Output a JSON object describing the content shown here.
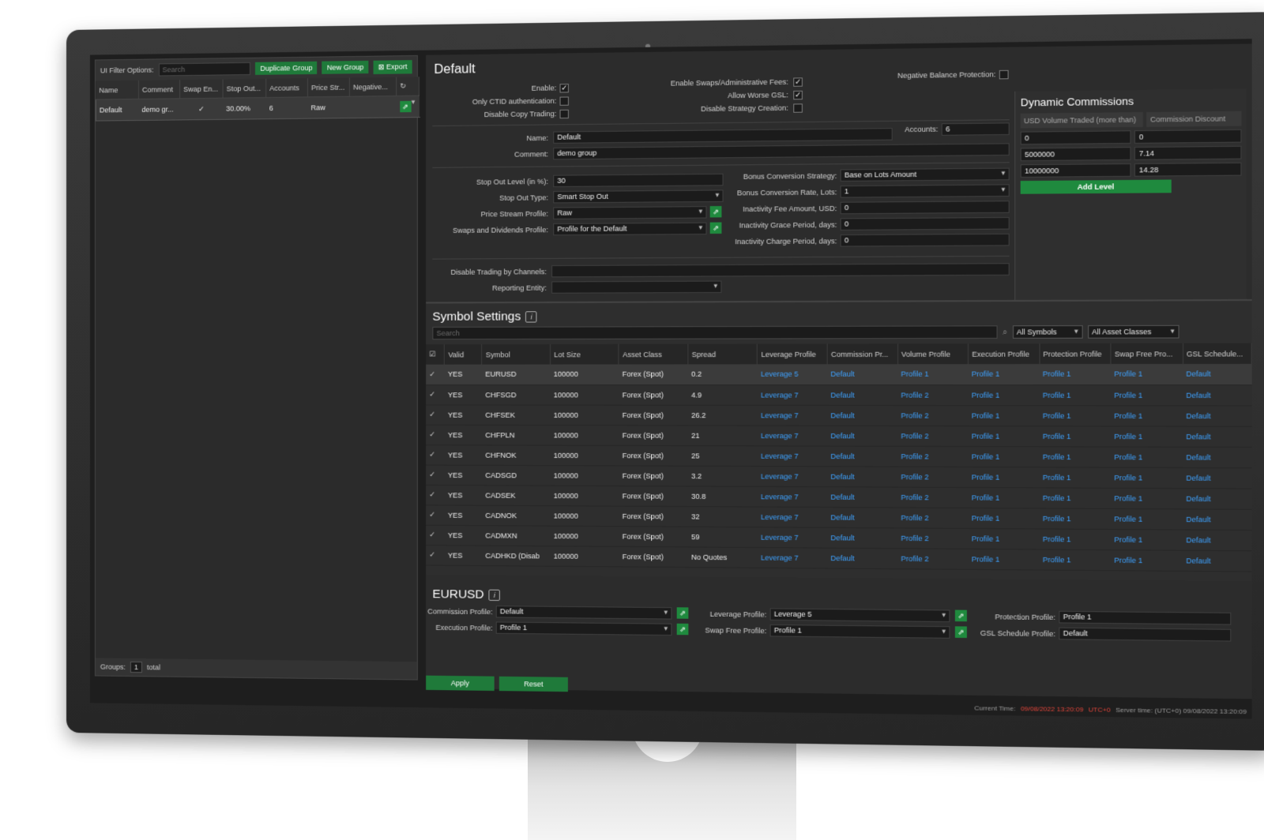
{
  "left_panel": {
    "filter_label": "UI Filter Options:",
    "search_placeholder": "Search",
    "duplicate_label": "Duplicate Group",
    "new_group_label": "New Group",
    "export_label": "Export",
    "columns": [
      "Name",
      "Comment",
      "Swap En...",
      "Stop Out...",
      "Accounts",
      "Price Str...",
      "Negative..."
    ],
    "rows": [
      {
        "name": "Default",
        "comment": "demo gr...",
        "swap": "✓",
        "stop_out": "30.00%",
        "accounts": "6",
        "price_stream": "Raw"
      }
    ],
    "groups_label": "Groups:",
    "groups_count": "1",
    "total_label": "total"
  },
  "group_form": {
    "title": "Default",
    "enable_label": "Enable:",
    "only_ctid_label": "Only CTID authentication:",
    "disable_copy_label": "Disable Copy Trading:",
    "enable_swaps_label": "Enable Swaps/Administrative Fees:",
    "allow_worse_gsl_label": "Allow Worse GSL:",
    "disable_strategy_label": "Disable Strategy Creation:",
    "negative_balance_label": "Negative Balance Protection:",
    "name_label": "Name:",
    "name_value": "Default",
    "accounts_label": "Accounts:",
    "accounts_value": "6",
    "comment_label": "Comment:",
    "comment_value": "demo group",
    "stop_out_level_label": "Stop Out Level (in %):",
    "stop_out_level_value": "30",
    "stop_out_type_label": "Stop Out Type:",
    "stop_out_type_value": "Smart Stop Out",
    "price_stream_label": "Price Stream Profile:",
    "price_stream_value": "Raw",
    "swaps_dividends_label": "Swaps and Dividends Profile:",
    "swaps_dividends_value": "Profile for the Default",
    "bonus_strategy_label": "Bonus Conversion Strategy:",
    "bonus_strategy_value": "Base on Lots Amount",
    "bonus_rate_label": "Bonus Conversion Rate, Lots:",
    "bonus_rate_value": "1",
    "inactivity_fee_label": "Inactivity Fee Amount, USD:",
    "inactivity_fee_value": "0",
    "inactivity_grace_label": "Inactivity Grace Period, days:",
    "inactivity_grace_value": "0",
    "inactivity_charge_label": "Inactivity Charge Period, days:",
    "inactivity_charge_value": "0",
    "disable_channels_label": "Disable Trading by Channels:",
    "reporting_entity_label": "Reporting Entity:"
  },
  "dynamic_commissions": {
    "title": "Dynamic Commissions",
    "col_volume": "USD Volume Traded (more than)",
    "col_discount": "Commission Discount",
    "rows": [
      [
        "0",
        "0"
      ],
      [
        "5000000",
        "7.14"
      ],
      [
        "10000000",
        "14.28"
      ]
    ],
    "add_level_label": "Add Level"
  },
  "symbol_settings": {
    "title": "Symbol Settings",
    "search_placeholder": "Search",
    "symbols_filter": "All Symbols",
    "asset_filter": "All Asset Classes",
    "columns": [
      "Valid",
      "Symbol",
      "Lot Size",
      "Asset Class",
      "Spread",
      "Leverage Profile",
      "Commission Pr...",
      "Volume Profile",
      "Execution Profile",
      "Protection Profile",
      "Swap Free Pro...",
      "GSL Schedule..."
    ],
    "rows": [
      [
        "YES",
        "EURUSD",
        "100000",
        "Forex (Spot)",
        "0.2",
        "Leverage 5",
        "Default",
        "Profile 1",
        "Profile 1",
        "Profile 1",
        "Profile 1",
        "Default"
      ],
      [
        "YES",
        "CHFSGD",
        "100000",
        "Forex (Spot)",
        "4.9",
        "Leverage 7",
        "Default",
        "Profile 2",
        "Profile 1",
        "Profile 1",
        "Profile 1",
        "Default"
      ],
      [
        "YES",
        "CHFSEK",
        "100000",
        "Forex (Spot)",
        "26.2",
        "Leverage 7",
        "Default",
        "Profile 2",
        "Profile 1",
        "Profile 1",
        "Profile 1",
        "Default"
      ],
      [
        "YES",
        "CHFPLN",
        "100000",
        "Forex (Spot)",
        "21",
        "Leverage 7",
        "Default",
        "Profile 2",
        "Profile 1",
        "Profile 1",
        "Profile 1",
        "Default"
      ],
      [
        "YES",
        "CHFNOK",
        "100000",
        "Forex (Spot)",
        "25",
        "Leverage 7",
        "Default",
        "Profile 2",
        "Profile 1",
        "Profile 1",
        "Profile 1",
        "Default"
      ],
      [
        "YES",
        "CADSGD",
        "100000",
        "Forex (Spot)",
        "3.2",
        "Leverage 7",
        "Default",
        "Profile 2",
        "Profile 1",
        "Profile 1",
        "Profile 1",
        "Default"
      ],
      [
        "YES",
        "CADSEK",
        "100000",
        "Forex (Spot)",
        "30.8",
        "Leverage 7",
        "Default",
        "Profile 2",
        "Profile 1",
        "Profile 1",
        "Profile 1",
        "Default"
      ],
      [
        "YES",
        "CADNOK",
        "100000",
        "Forex (Spot)",
        "32",
        "Leverage 7",
        "Default",
        "Profile 2",
        "Profile 1",
        "Profile 1",
        "Profile 1",
        "Default"
      ],
      [
        "YES",
        "CADMXN",
        "100000",
        "Forex (Spot)",
        "59",
        "Leverage 7",
        "Default",
        "Profile 2",
        "Profile 1",
        "Profile 1",
        "Profile 1",
        "Default"
      ],
      [
        "YES",
        "CADHKD (Disab",
        "100000",
        "Forex (Spot)",
        "No Quotes",
        "Leverage 7",
        "Default",
        "Profile 2",
        "Profile 1",
        "Profile 1",
        "Profile 1",
        "Default"
      ]
    ]
  },
  "symbol_detail": {
    "title": "EURUSD",
    "commission_label": "Commission Profile:",
    "commission_value": "Default",
    "leverage_label": "Leverage Profile:",
    "leverage_value": "Leverage 5",
    "protection_label": "Protection Profile:",
    "protection_value": "Profile 1",
    "execution_label": "Execution Profile:",
    "execution_value": "Profile 1",
    "swap_free_label": "Swap Free Profile:",
    "swap_free_value": "Profile 1",
    "gsl_label": "GSL Schedule Profile:",
    "gsl_value": "Default"
  },
  "actions": {
    "apply_label": "Apply",
    "reset_label": "Reset"
  },
  "status_bar": {
    "current_time_label": "Current Time:",
    "current_time_value": "09/08/2022 13:20:09",
    "tz": "UTC+0",
    "server_time": "Server time: (UTC+0) 09/08/2022 13:20:09"
  },
  "colors": {
    "accent_green": "#1f8a3e",
    "link_blue": "#3ea2ff",
    "time_red": "#e2453a"
  }
}
